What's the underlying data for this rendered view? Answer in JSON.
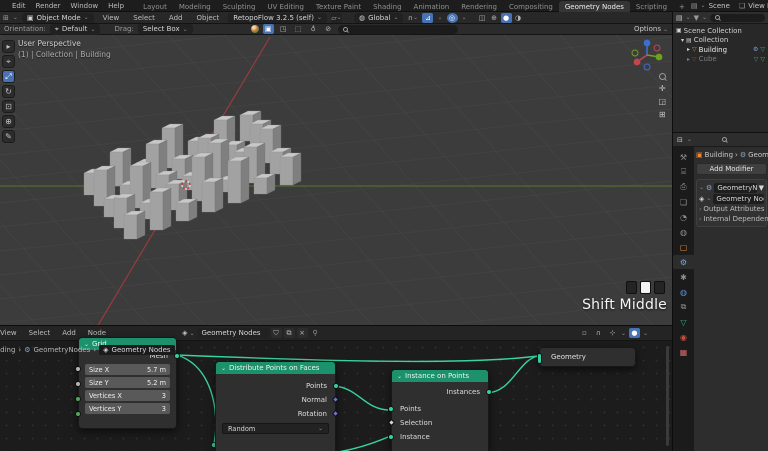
{
  "topbar": {
    "menus": [
      "Edit",
      "Render",
      "Window",
      "Help"
    ],
    "workspaces": [
      "Layout",
      "Modeling",
      "Sculpting",
      "UV Editing",
      "Texture Paint",
      "Shading",
      "Animation",
      "Rendering",
      "Compositing",
      "Geometry Nodes",
      "Scripting"
    ],
    "add_tab": "+",
    "scene": "Scene",
    "view_layer": "View La"
  },
  "header": {
    "mode": "Object Mode",
    "menus": [
      "View",
      "Select",
      "Add",
      "Object"
    ],
    "addon": "RetopoFlow 3.2.5 (self)",
    "transform_orientation": "Global",
    "options": "Options"
  },
  "tool_settings": {
    "orientation_label": "Orientation:",
    "orientation_value": "Default",
    "drag_label": "Drag:",
    "drag_value": "Select Box"
  },
  "viewport": {
    "view_label": "User Perspective",
    "context_label": "(1) | Collection | Building",
    "screencast": "Shift Middle"
  },
  "outliner": {
    "rows": [
      "Scene Collection",
      "Collection",
      "Building",
      "Cube"
    ]
  },
  "properties": {
    "breadcrumb_object": "Building",
    "breadcrumb_modifier": "Geometr",
    "add_modifier": "Add Modifier",
    "modifier_name": "GeometryNod...",
    "node_group": "Geometry Nodes",
    "section_1": "Output Attributes",
    "section_2": "Internal Dependencies"
  },
  "node_editor": {
    "menus": [
      "View",
      "Select",
      "Add",
      "Node"
    ],
    "datablock": "Geometry Nodes",
    "breadcrumb": [
      "Building",
      "GeometryNodes",
      "Geometry Nodes"
    ],
    "grid_node": {
      "title": "Grid",
      "output": "Mesh",
      "rows": [
        {
          "label": "Size X",
          "value": "5.7 m"
        },
        {
          "label": "Size Y",
          "value": "5.2 m"
        },
        {
          "label": "Vertices X",
          "value": "3"
        },
        {
          "label": "Vertices Y",
          "value": "3"
        }
      ]
    },
    "distribute_node": {
      "title": "Distribute Points on Faces",
      "outputs": [
        "Points",
        "Normal",
        "Rotation"
      ],
      "method": "Random"
    },
    "instance_node": {
      "title": "Instance on Points",
      "output": "Instances",
      "inputs": [
        "Points",
        "Selection",
        "Instance"
      ]
    },
    "output_node": {
      "input": "Geometry"
    }
  },
  "colors": {
    "accent": "#4772b3",
    "node_header": "#1c926c",
    "wire": "#3ad29f",
    "socket_geometry": "#31d0a0",
    "socket_vector": "#6d76d6",
    "axis_x": "#9e3b40",
    "axis_y": "#55792e",
    "grid_line": "#474747"
  }
}
